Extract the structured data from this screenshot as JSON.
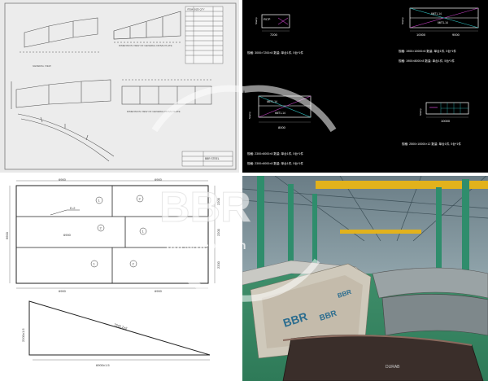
{
  "cad_sheet": {
    "plan_title_1": "DIMENSION VIEW OF GENERAL DRIVE PLATE",
    "plan_title_2": "DIMENSION VIEW OF GENERAL DRIVE PLATE",
    "table_header": "ITEM  SIZE  QTY",
    "title_block": "BBR STEEL"
  },
  "nesting_plans": {
    "piece_a_label": "RCP",
    "piece_a_dim": "7200",
    "piece_a_caption": "规格: 3000×7200×8  数量: 单台1件, 5台*1件",
    "piece_b_labels": [
      "6MT1-14",
      "6MT1-14"
    ],
    "piece_b_dims": [
      "10000",
      "9000"
    ],
    "piece_b_caption": "规格: 1900×10000×8  数量: 单台1件, 5台*1件",
    "piece_b_caption_2": "规格: 1900×8000×8  数量: 单台1件, 5台*1件",
    "piece_c_labels": [
      "6MT1-14",
      "6MT1-14"
    ],
    "piece_c_dim": "8000",
    "piece_c_caption": "规格: 2300×8000×8  数量: 单台1件, 5台*1件",
    "piece_c_caption_2": "规格: 2300×8000×8  数量: 单台1件, 5台*1件",
    "piece_d_dim": "10000",
    "piece_d_caption": "规格: 2500×10000×12  数量: 单台1件, 5台*1件",
    "vertical_labels": [
      "Stamp",
      "Stamp",
      "Stamp",
      "Stamp"
    ]
  },
  "cutting_layout": {
    "top_dim_left": "6900",
    "top_dim_right": "6900",
    "middle_dim": "6900",
    "bottom_dim_left": "6900",
    "bottom_dim_right": "6900",
    "left_dim": "6600",
    "right_dim_1": "2200",
    "right_dim_2": "2200",
    "right_dim_3": "2200",
    "cut_note": "D-2",
    "piece_numbers": [
      "1",
      "2",
      "2",
      "1",
      "1",
      "2"
    ],
    "tri_hyp": "7242.2±2",
    "tri_height": "2200±1.5",
    "tri_base": "6900±1.5"
  },
  "watermark": {
    "logo": "BBR",
    "url": "bbr@bebon.cn"
  },
  "photo": {
    "bundle_labels": [
      "BBR",
      "BBR",
      "BBR"
    ],
    "plate_text": "DURAB"
  }
}
